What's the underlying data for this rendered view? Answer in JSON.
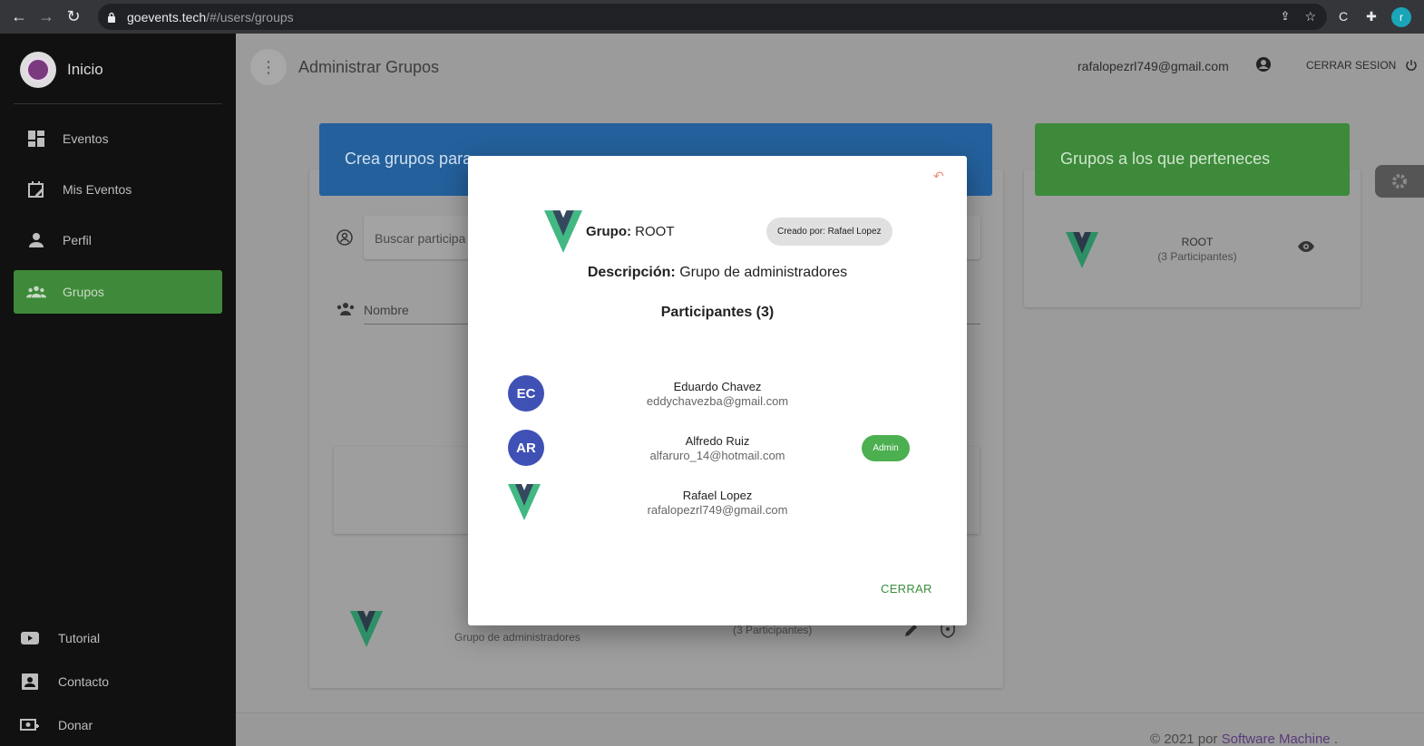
{
  "browser": {
    "url_host": "goevents.tech",
    "url_path": "/#/users/groups",
    "profile_initial": "r"
  },
  "sidebar": {
    "brand_label": "Inicio",
    "items": [
      {
        "label": "Eventos",
        "icon": "dashboard-icon"
      },
      {
        "label": "Mis Eventos",
        "icon": "calendar-edit-icon"
      },
      {
        "label": "Perfil",
        "icon": "person-icon"
      },
      {
        "label": "Grupos",
        "icon": "groups-icon",
        "active": true
      }
    ],
    "bottom_items": [
      {
        "label": "Tutorial",
        "icon": "youtube-icon"
      },
      {
        "label": "Contacto",
        "icon": "contact-card-icon"
      },
      {
        "label": "Donar",
        "icon": "donate-icon"
      }
    ]
  },
  "header": {
    "title": "Administrar Grupos",
    "user_email": "rafalopezrl749@gmail.com",
    "logout_label": "CERRAR SESION"
  },
  "main": {
    "create_banner": "Crea grupos para",
    "search_placeholder": "Buscar participa",
    "name_label": "Nombre",
    "row": {
      "description": "Grupo de administradores",
      "participants": "(3 Participantes)"
    }
  },
  "my_groups": {
    "title": "Grupos a los que perteneces",
    "items": [
      {
        "name": "ROOT",
        "count": "(3 Participantes)"
      }
    ]
  },
  "footer": {
    "prefix": "© 2021 por ",
    "link": "Software Machine",
    "suffix": " ."
  },
  "modal": {
    "group_label": "Grupo:",
    "group_name": "ROOT",
    "creator": "Creado por: Rafael Lopez",
    "description_label": "Descripción:",
    "description": "Grupo de administradores",
    "participants_title": "Participantes (3)",
    "participants": [
      {
        "initials": "EC",
        "name": "Eduardo Chavez",
        "email": "eddychavezba@gmail.com",
        "badge": ""
      },
      {
        "initials": "AR",
        "name": "Alfredo Ruiz",
        "email": "alfaruro_14@hotmail.com",
        "badge": "Admin"
      },
      {
        "initials": "",
        "name": "Rafael Lopez",
        "email": "rafalopezrl749@gmail.com",
        "badge": ""
      }
    ],
    "close_label": "CERRAR"
  },
  "colors": {
    "sidebar_bg": "#111111",
    "active_green": "#3f8a3a",
    "banner_blue": "#24609c",
    "banner_green": "#3d8a3a",
    "avatar_blue": "#3f51b5",
    "badge_green": "#4caf50",
    "vue_green": "#42b883",
    "vue_dark": "#35495e"
  }
}
